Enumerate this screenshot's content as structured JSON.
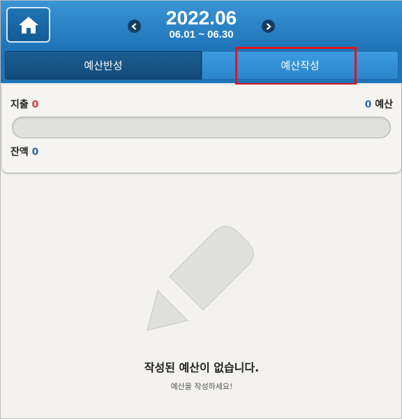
{
  "header": {
    "month": "2022.06",
    "range": "06.01 ~ 06.30",
    "icons": {
      "home": "home-icon",
      "prev": "chevron-left-icon",
      "next": "chevron-right-icon"
    }
  },
  "tabs": [
    {
      "label": "예산반성",
      "selected": true
    },
    {
      "label": "예산작성",
      "selected": false
    }
  ],
  "summary": {
    "spend_label": "지출",
    "spend_value": "0",
    "budget_value": "0",
    "budget_label": "예산",
    "balance_label": "잔액",
    "balance_value": "0",
    "progress": 0
  },
  "empty_state": {
    "icon": "pencil-icon",
    "title": "작성된 예산이 없습니다.",
    "subtitle": "예산을 작성하세요!"
  },
  "colors": {
    "header": "#2a85cb",
    "spend": "#d43a3a",
    "value_blue": "#2a6aa6",
    "highlight": "#e0141b"
  }
}
